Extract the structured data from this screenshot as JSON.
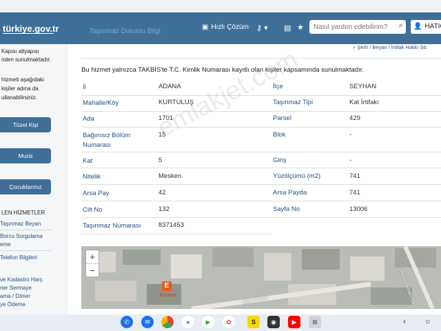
{
  "header": {
    "logo": "türkiye.gov.tr",
    "faint_link": "Taşınmaz Durumu Bilgi",
    "hizli_cozum": "Hızlı Çözüm",
    "search_placeholder": "Nasıl yardım edebilirim?",
    "user_name": "HATICE"
  },
  "sidebar": {
    "top_text": [
      "Kapısı altyapısı",
      "nden sunulmaktadır."
    ],
    "info_text": [
      "hizmeti aşağıdaki",
      "kişiler adına da",
      "ullanabilirsiniz."
    ],
    "buttons": [
      "Tüzel Kişi",
      "Muris",
      "Çocuklarınız"
    ],
    "section_title": "LEN HİZMETLER",
    "links": [
      "Taşınmaz Beyan",
      "Borcu Sorgulama",
      "eme",
      "Telefon Bilgileri"
    ],
    "bottom_links": [
      "ve Kadastro Harç",
      "ner Sermaye",
      "ama / Döner",
      "ye Ödeme"
    ]
  },
  "breadcrumb": "Şerh / Beyan / İrtifak Hakkı Sö",
  "intro": "Bu hizmet yalnızca TAKBİS'te T.C. Kimlik Numarası kayıtlı olan kişiler kapsamında sunulmaktadır.",
  "details": {
    "rows": [
      {
        "l1": "İl",
        "v1": "ADANA",
        "l2": "İlçe",
        "v2": "SEYHAN"
      },
      {
        "l1": "Mahalle/Köy",
        "v1": "KURTULUŞ",
        "l2": "Taşınmaz Tipi",
        "v2": "Kat İrtifakı"
      },
      {
        "l1": "Ada",
        "v1": "1701",
        "l2": "Parsel",
        "v2": "429"
      },
      {
        "l1": "Bağımsız Bölüm Numarası",
        "v1": "15",
        "l2": "Blok",
        "v2": "-"
      },
      {
        "l1": "Kat",
        "v1": "5",
        "l2": "Giriş",
        "v2": "-"
      },
      {
        "l1": "Nitelik",
        "v1": "Mesken",
        "l2": "Yüzölçümü (m2)",
        "v2": "741"
      },
      {
        "l1": "Arsa Pay",
        "v1": "42",
        "l2": "Arsa Payda",
        "v2": "741"
      },
      {
        "l1": "Cilt No",
        "v1": "132",
        "l2": "Sayfa No",
        "v2": "13006"
      },
      {
        "l1": "Taşınmaz Numarası",
        "v1": "8371453",
        "l2": "",
        "v2": ""
      }
    ]
  },
  "map": {
    "zoom_in": "+",
    "zoom_out": "−",
    "poi_label": "Eczane",
    "street_1": "Şiltin Bulvar",
    "street_2": "İnönü Osman Ca"
  },
  "watermark": "emlakjet.com",
  "taskbar": {
    "apps": [
      "phone-icon",
      "messages-icon",
      "chrome-icon",
      "assistant-icon",
      "play-store-icon",
      "photos-icon",
      "sahibinden-icon",
      "camera-icon",
      "youtube-icon",
      "app-grid-icon"
    ],
    "sahibinden_letter": "S",
    "back": "‹",
    "home": "○"
  }
}
